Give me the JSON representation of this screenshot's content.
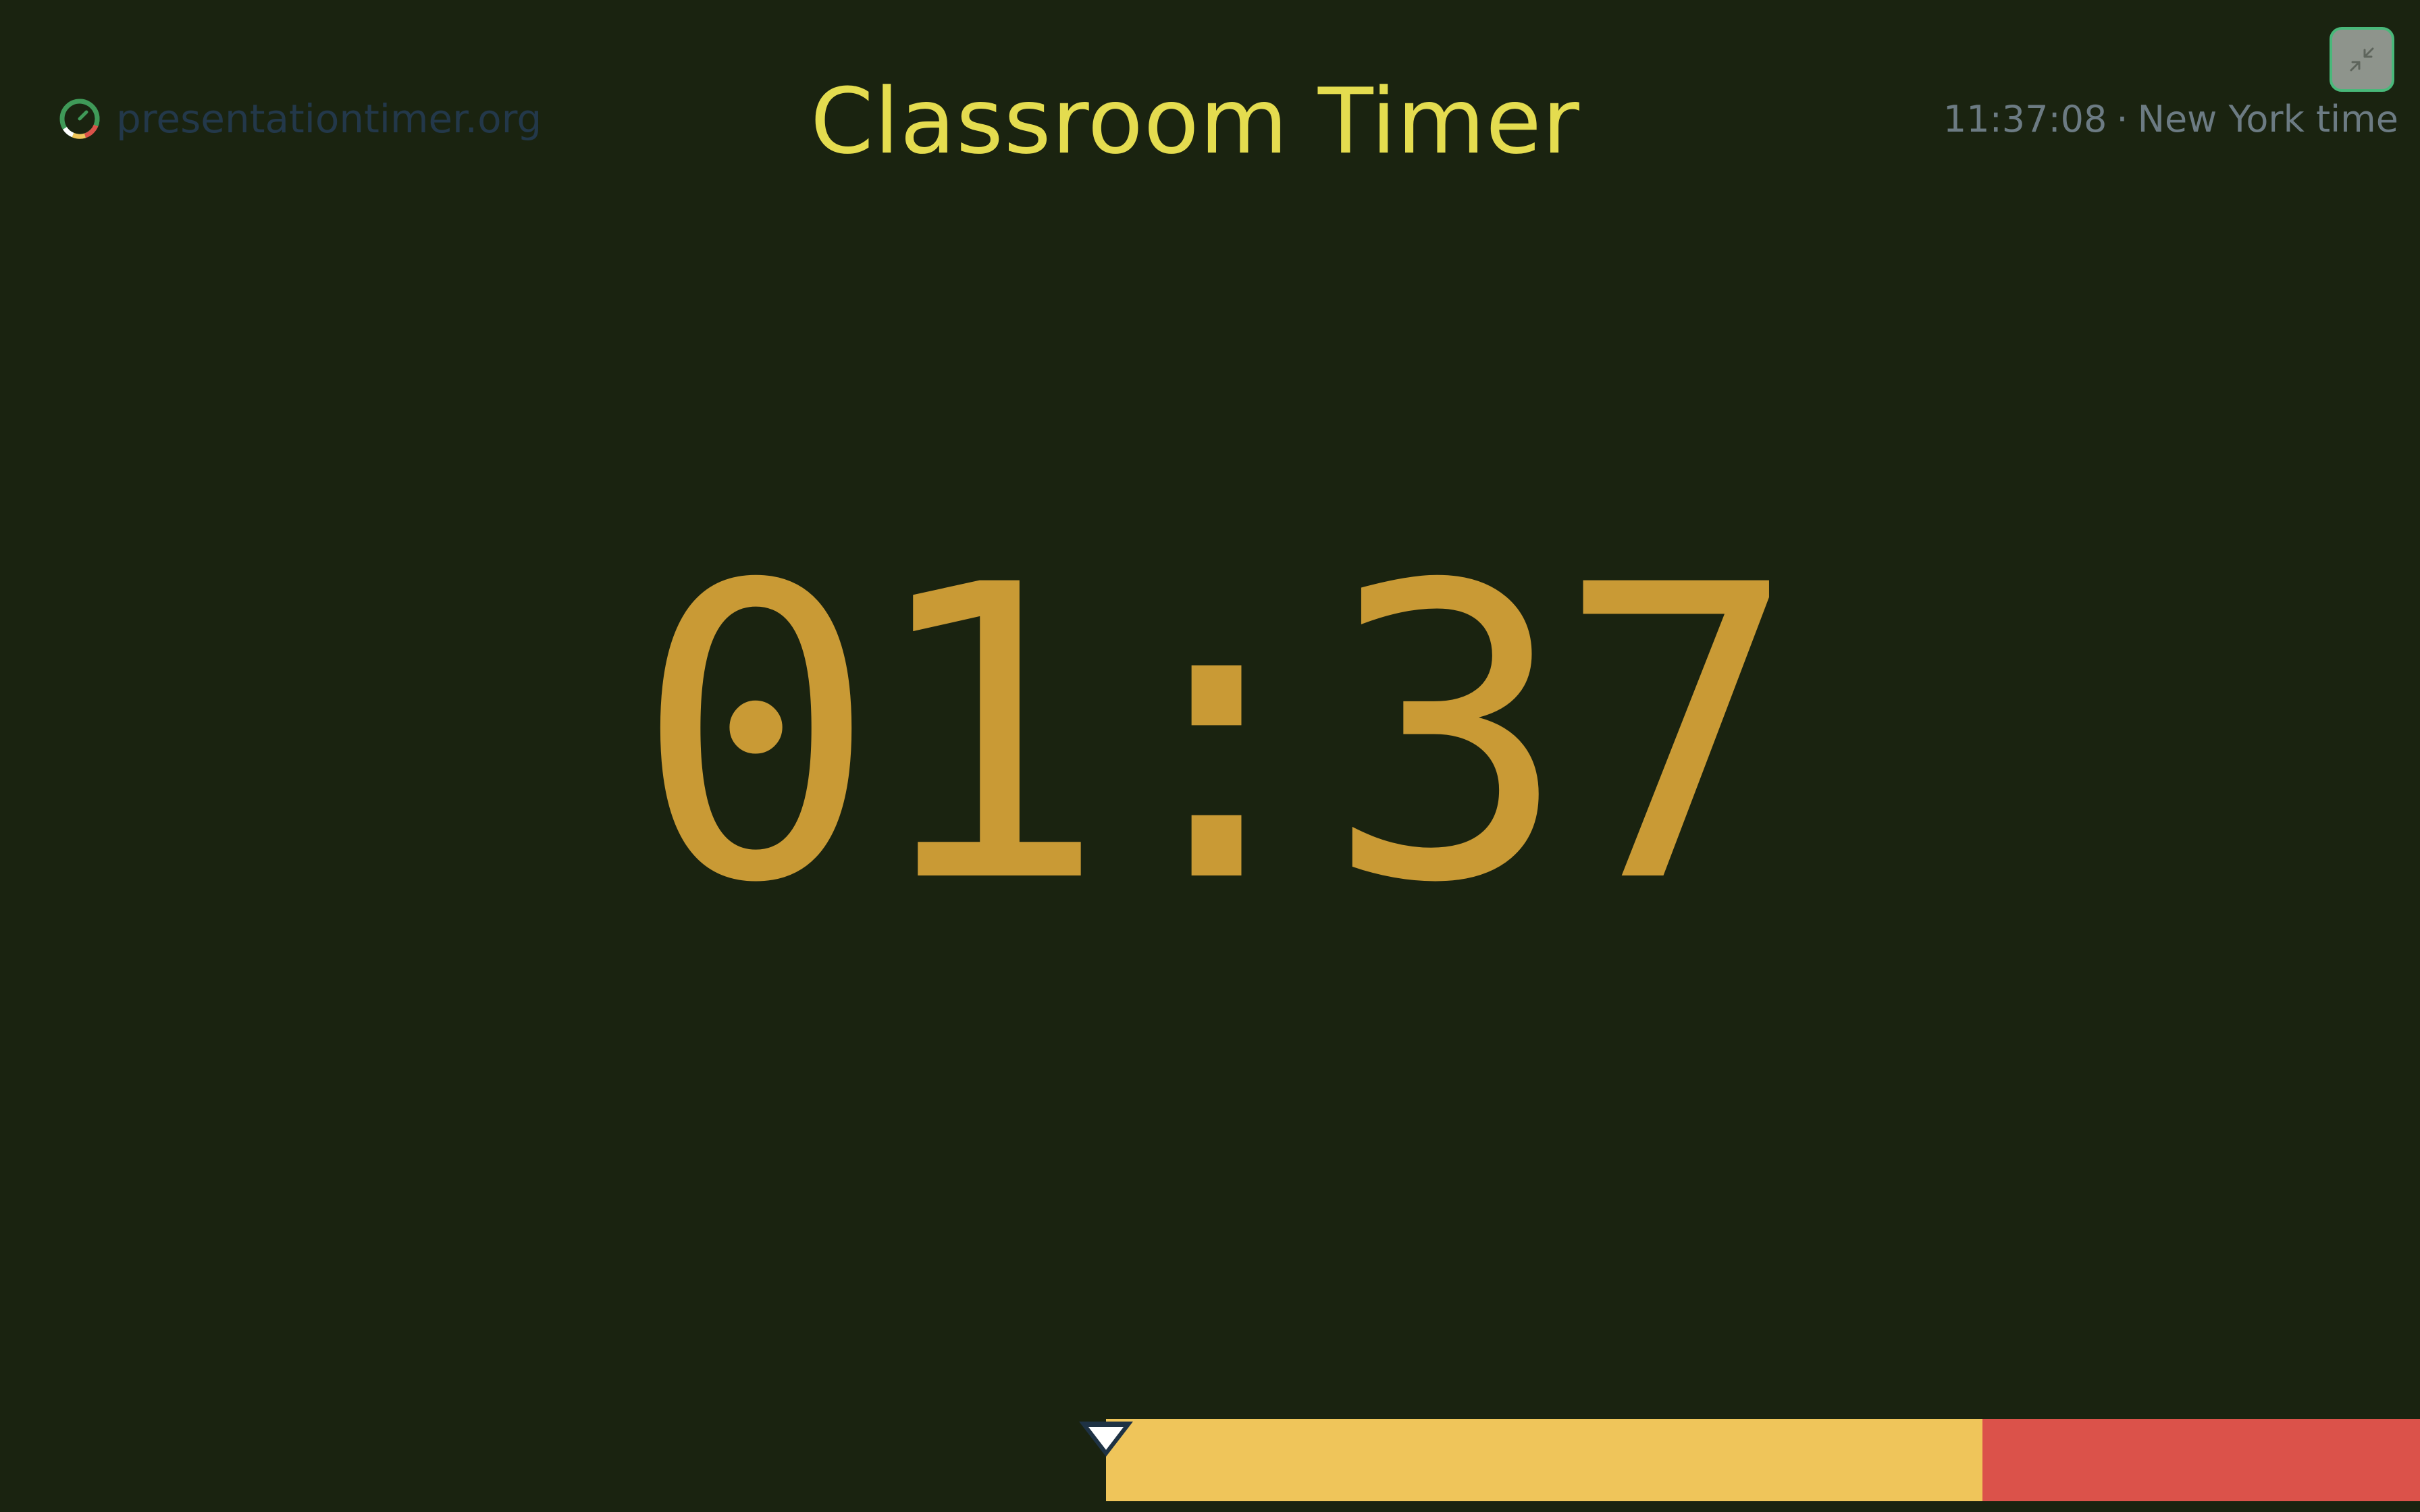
{
  "brand": {
    "name": "presentationtimer.org",
    "logo_icon": "timer-ring-icon",
    "logo_colors": [
      "#3f9a58",
      "#efc55a",
      "#db524a",
      "#ffffff"
    ]
  },
  "header": {
    "title": "Classroom Timer"
  },
  "clock": {
    "time": "11:37:08",
    "separator": "·",
    "zone": "New York time"
  },
  "controls": {
    "exit_fullscreen_icon": "exit-fullscreen-icon"
  },
  "timer": {
    "display": "01:37"
  },
  "progress": {
    "elapsed_fraction": 0.0,
    "yellow_fraction": 0.667,
    "red_fraction": 0.333,
    "colors": {
      "yellow": "#efc55a",
      "red": "#db524a",
      "background": "#1a2310"
    }
  },
  "colors": {
    "title": "#e4dc4f",
    "timer": "#c99a35",
    "brand_text": "#23384a",
    "clock_text": "#6c7b83"
  }
}
